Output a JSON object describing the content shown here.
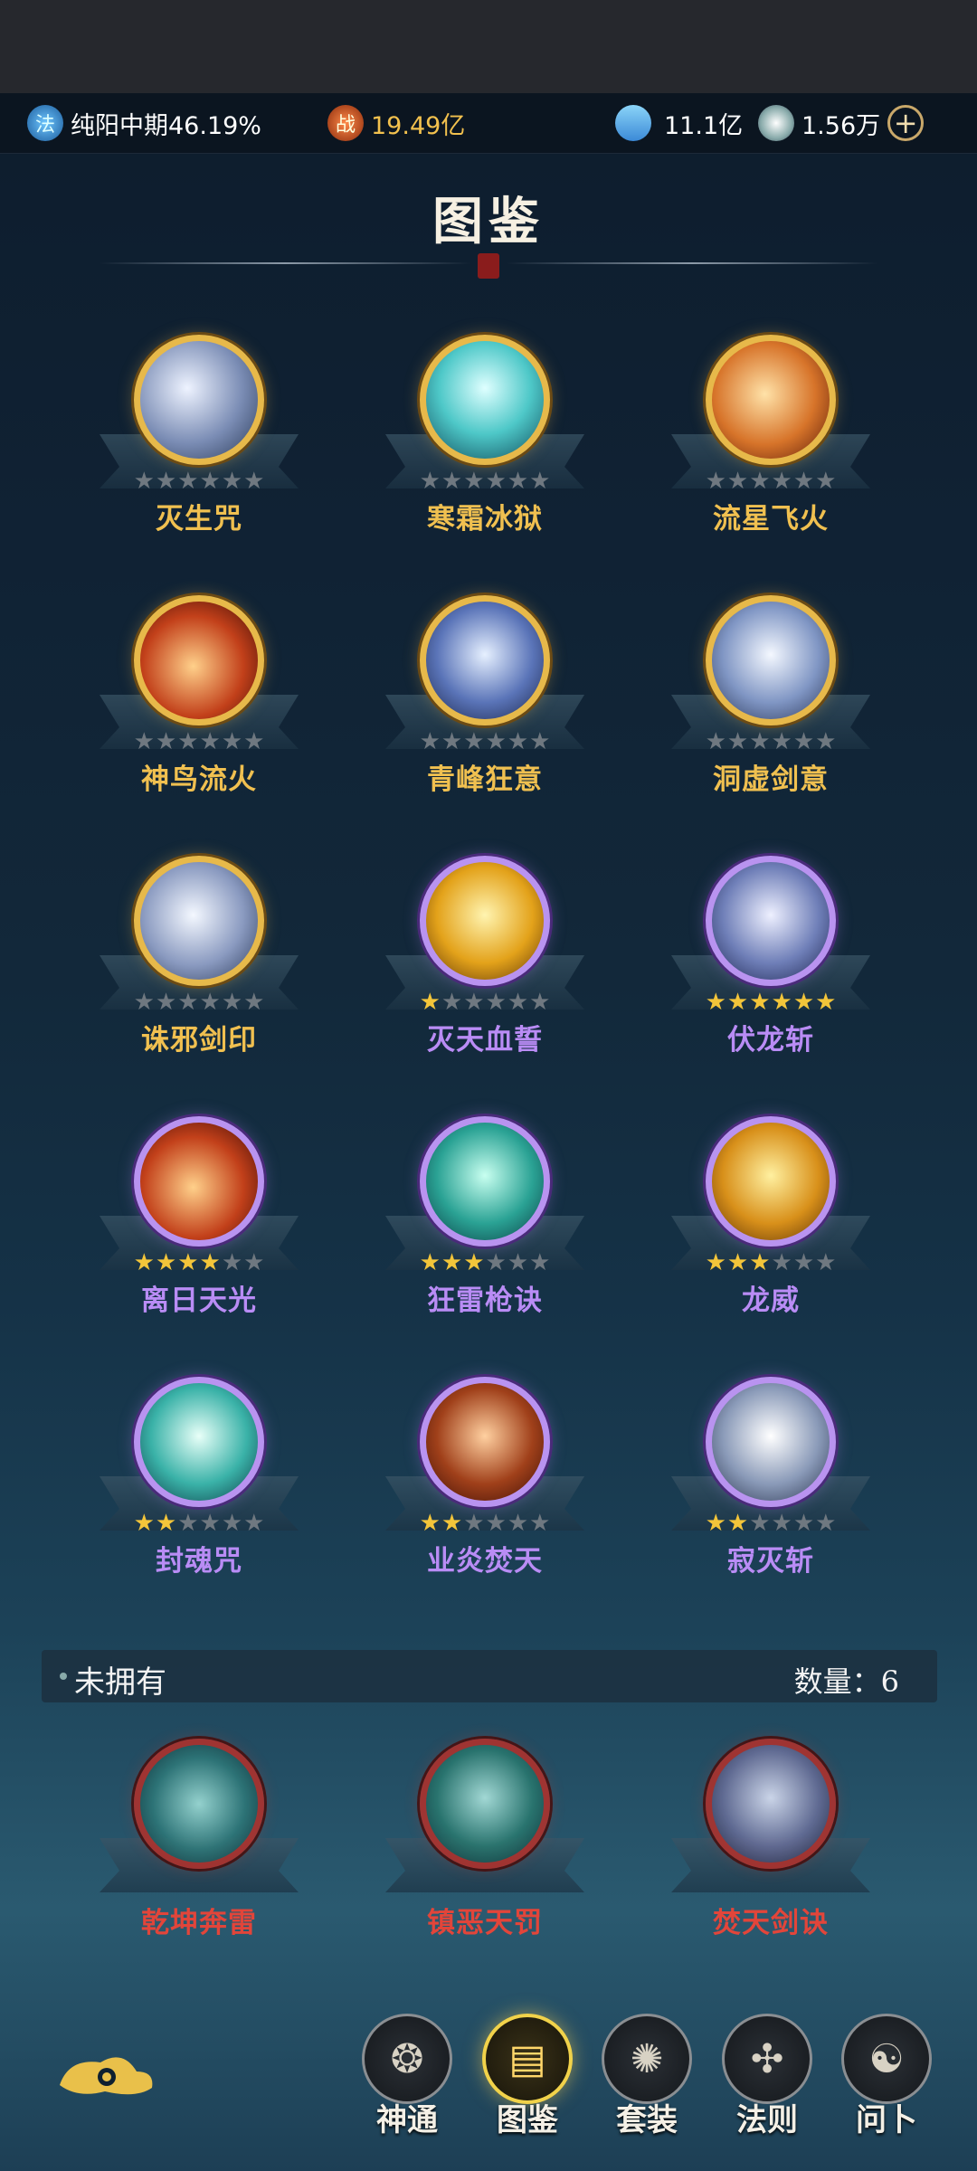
{
  "status_bar": {
    "realm": "纯阳中期46.19%",
    "realm_icon": "法",
    "power": "19.49亿",
    "power_icon": "战",
    "spirit_stone": "11.1亿",
    "currency": "1.56万",
    "add_icon": "+",
    "colors": {
      "power": "#f2c14e",
      "text": "#ffffff"
    }
  },
  "title": "图鉴",
  "owned_skills": [
    {
      "name": "灭生咒",
      "rarity": "gold",
      "stars": 0,
      "stars_max": 6
    },
    {
      "name": "寒霜冰狱",
      "rarity": "gold",
      "stars": 0,
      "stars_max": 6
    },
    {
      "name": "流星飞火",
      "rarity": "gold",
      "stars": 0,
      "stars_max": 6
    },
    {
      "name": "神鸟流火",
      "rarity": "gold",
      "stars": 0,
      "stars_max": 6
    },
    {
      "name": "青峰狂意",
      "rarity": "gold",
      "stars": 0,
      "stars_max": 6
    },
    {
      "name": "洞虚剑意",
      "rarity": "gold",
      "stars": 0,
      "stars_max": 6
    },
    {
      "name": "诛邪剑印",
      "rarity": "gold",
      "stars": 0,
      "stars_max": 6
    },
    {
      "name": "灭天血誓",
      "rarity": "purple",
      "stars": 1,
      "stars_max": 6
    },
    {
      "name": "伏龙斩",
      "rarity": "purple",
      "stars": 6,
      "stars_max": 6
    },
    {
      "name": "离日天光",
      "rarity": "purple",
      "stars": 4,
      "stars_max": 6
    },
    {
      "name": "狂雷枪诀",
      "rarity": "purple",
      "stars": 3,
      "stars_max": 6
    },
    {
      "name": "龙威",
      "rarity": "purple",
      "stars": 3,
      "stars_max": 6
    },
    {
      "name": "封魂咒",
      "rarity": "purple",
      "stars": 2,
      "stars_max": 6
    },
    {
      "name": "业炎焚天",
      "rarity": "purple",
      "stars": 2,
      "stars_max": 6
    },
    {
      "name": "寂灭斩",
      "rarity": "purple",
      "stars": 2,
      "stars_max": 6
    }
  ],
  "unowned_section": {
    "label": "未拥有",
    "count_label": "数量：6"
  },
  "unowned_skills": [
    {
      "name": "乾坤奔雷",
      "rarity": "red"
    },
    {
      "name": "镇恶天罚",
      "rarity": "red"
    },
    {
      "name": "焚天剑诀",
      "rarity": "red"
    }
  ],
  "bottom_nav": [
    {
      "label": "神通",
      "icon": "shentong-icon",
      "glyph": "❂",
      "active": false
    },
    {
      "label": "图鉴",
      "icon": "tujian-icon",
      "glyph": "▤",
      "active": true
    },
    {
      "label": "套装",
      "icon": "fan-icon",
      "glyph": "✺",
      "active": false
    },
    {
      "label": "法则",
      "icon": "law-icon",
      "glyph": "✣",
      "active": false
    },
    {
      "label": "问卜",
      "icon": "divination-icon",
      "glyph": "☯",
      "active": false
    }
  ],
  "colors": {
    "gold_rarity": "#e7b94a",
    "purple_rarity": "#b993f0",
    "red_rarity": "#b5302a",
    "star_on": "#f3c53a"
  }
}
